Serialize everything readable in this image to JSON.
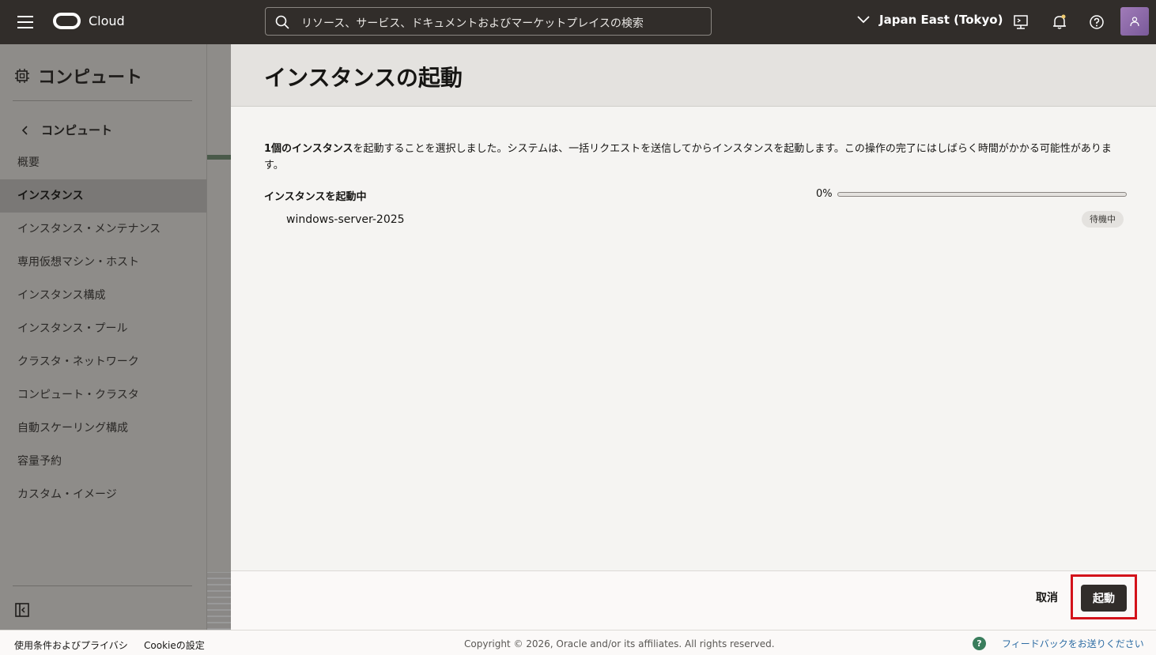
{
  "header": {
    "brand": "Cloud",
    "search_placeholder": "リソース、サービス、ドキュメントおよびマーケットプレイスの検索",
    "region": "Japan East (Tokyo)"
  },
  "sidebar": {
    "title": "コンピュート",
    "back_label": "コンピュート",
    "items": [
      {
        "label": "概要"
      },
      {
        "label": "インスタンス"
      },
      {
        "label": "インスタンス・メンテナンス"
      },
      {
        "label": "専用仮想マシン・ホスト"
      },
      {
        "label": "インスタンス構成"
      },
      {
        "label": "インスタンス・プール"
      },
      {
        "label": "クラスタ・ネットワーク"
      },
      {
        "label": "コンピュート・クラスタ"
      },
      {
        "label": "自動スケーリング構成"
      },
      {
        "label": "容量予約"
      },
      {
        "label": "カスタム・イメージ"
      }
    ],
    "active_index": 1
  },
  "panel": {
    "title": "インスタンスの起動",
    "desc_bold": "1個のインスタンス",
    "desc_rest": "を起動することを選択しました。システムは、一括リクエストを送信してからインスタンスを起動します。この操作の完了にはしばらく時間がかかる可能性があります。",
    "progress_label": "インスタンスを起動中",
    "progress_percent_text": "0%",
    "progress_value": 0,
    "instance_name": "windows-server-2025",
    "instance_status": "待機中",
    "cancel_label": "取消",
    "launch_label": "起動"
  },
  "footer": {
    "terms": "使用条件およびプライバシ",
    "cookie": "Cookieの設定",
    "copyright": "Copyright © 2026, Oracle and/or its affiliates. All rights reserved.",
    "feedback": "フィードバックをお送りください"
  },
  "colors": {
    "header_bg": "#312d2a",
    "accent_green": "#3a7d5c",
    "highlight_red": "#d3121a",
    "link_blue": "#2e6da4"
  }
}
